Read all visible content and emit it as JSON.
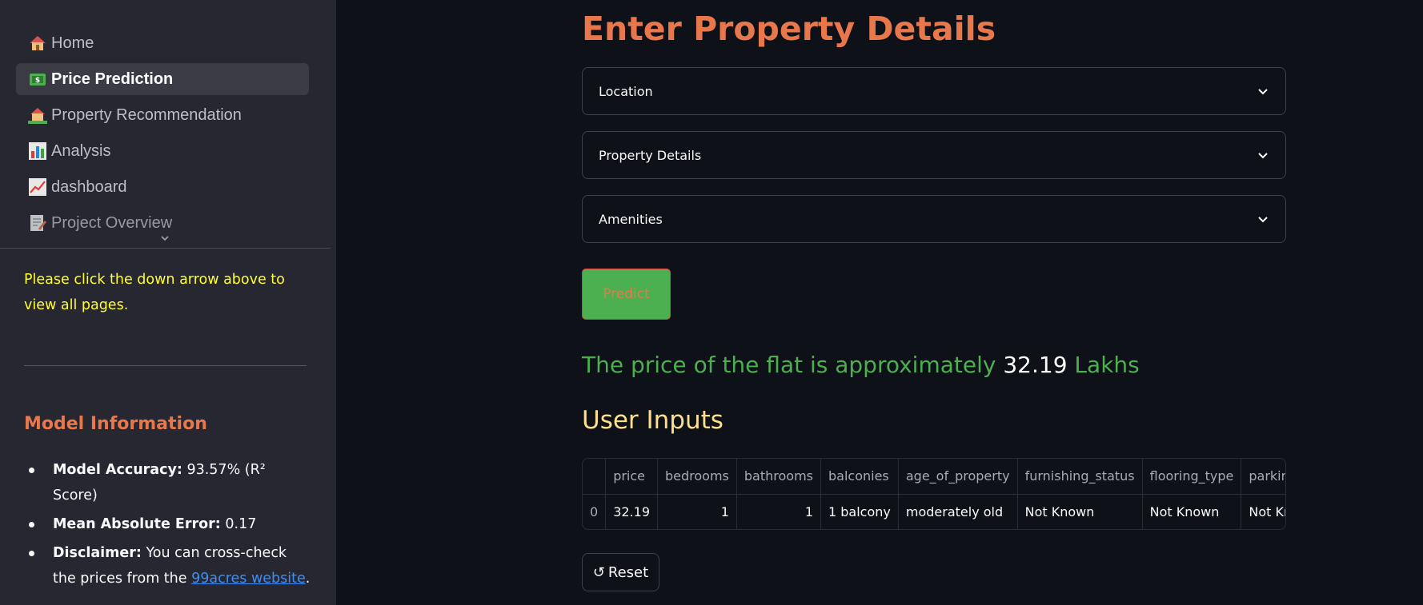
{
  "sidebar": {
    "nav": [
      {
        "icon": "house-icon",
        "label": "Home"
      },
      {
        "icon": "money-icon",
        "label": "Price Prediction"
      },
      {
        "icon": "house-garden-icon",
        "label": "Property Recommendation"
      },
      {
        "icon": "bar-chart-icon",
        "label": "Analysis"
      },
      {
        "icon": "chart-increasing-icon",
        "label": "dashboard"
      },
      {
        "icon": "memo-icon",
        "label": "Project Overview"
      }
    ],
    "note": "Please click the down arrow above to view all pages.",
    "model_title": "Model Information",
    "model_info": [
      {
        "label": "Model Accuracy:",
        "text": " 93.57% (R² Score)"
      },
      {
        "label": "Mean Absolute Error:",
        "text": " 0.17"
      },
      {
        "label": "Disclaimer:",
        "text": " You can cross-check the prices from the ",
        "link": "99acres website",
        "after": "."
      }
    ]
  },
  "main": {
    "title": "Enter Property Details",
    "expanders": [
      "Location",
      "Property Details",
      "Amenities"
    ],
    "predict_label": "Predict",
    "result": {
      "prefix": "The price of the flat is approximately ",
      "value": "32.19",
      "suffix": " Lakhs"
    },
    "user_inputs_title": "User Inputs",
    "table": {
      "columns": [
        "",
        "price",
        "bedrooms",
        "bathrooms",
        "balconies",
        "age_of_property",
        "furnishing_status",
        "flooring_type",
        "parking"
      ],
      "rows": [
        [
          "0",
          "32.19",
          "1",
          "1",
          "1 balcony",
          "moderately old",
          "Not Known",
          "Not Known",
          "Not Known"
        ]
      ]
    },
    "reset_label": "Reset",
    "reset_icon": "↺"
  },
  "colors": {
    "accent": "#e8784c",
    "success": "#4caf50",
    "note": "#ffff33",
    "link": "#3f8ef5",
    "subheading": "#ffe08a"
  }
}
